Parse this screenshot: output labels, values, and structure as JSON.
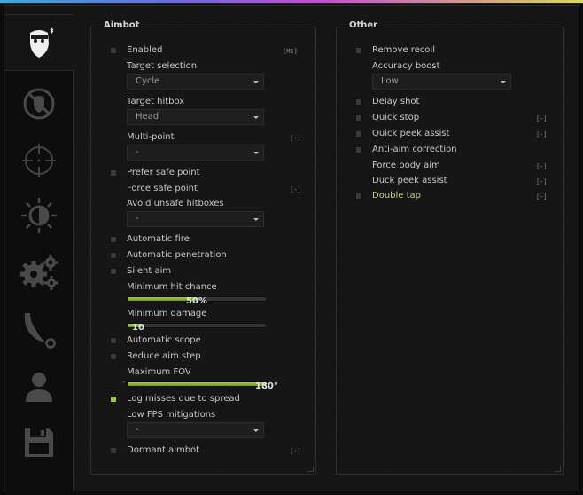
{
  "sidebar": {
    "tabs": [
      {
        "icon": "terrorist-head-icon",
        "active": true
      },
      {
        "icon": "anti-aim-icon",
        "active": false
      },
      {
        "icon": "crosshair-icon",
        "active": false
      },
      {
        "icon": "visuals-icon",
        "active": false
      },
      {
        "icon": "gears-icon",
        "active": false
      },
      {
        "icon": "knife-icon",
        "active": false
      },
      {
        "icon": "player-icon",
        "active": false
      },
      {
        "icon": "save-icon",
        "active": false
      }
    ]
  },
  "aimbot": {
    "title": "Aimbot",
    "enabled": "Enabled",
    "enabled_key": "[M5]",
    "target_selection": "Target selection",
    "target_selection_value": "Cycle",
    "target_hitbox": "Target hitbox",
    "target_hitbox_value": "Head",
    "multi_point": "Multi-point",
    "multi_point_key": "[-]",
    "multi_point_value": "-",
    "prefer_safe_point": "Prefer safe point",
    "force_safe_point": "Force safe point",
    "force_safe_point_key": "[-]",
    "avoid_unsafe_hitboxes": "Avoid unsafe hitboxes",
    "avoid_unsafe_value": "-",
    "automatic_fire": "Automatic fire",
    "automatic_penetration": "Automatic penetration",
    "silent_aim": "Silent aim",
    "min_hit_chance": "Minimum hit chance",
    "min_hit_chance_value": "50%",
    "min_hit_chance_level": 50,
    "min_damage": "Minimum damage",
    "min_damage_value": "10",
    "min_damage_level": 10,
    "automatic_scope": "Automatic scope",
    "reduce_aim_step": "Reduce aim step",
    "max_fov": "Maximum FOV",
    "max_fov_value": "180°",
    "max_fov_level": 100,
    "max_fov_minus": "-",
    "log_misses": "Log misses due to spread",
    "low_fps": "Low FPS mitigations",
    "low_fps_value": "-",
    "dormant_aimbot": "Dormant aimbot",
    "dormant_key": "[-]"
  },
  "other": {
    "title": "Other",
    "remove_recoil": "Remove recoil",
    "accuracy_boost": "Accuracy boost",
    "accuracy_boost_value": "Low",
    "delay_shot": "Delay shot",
    "quick_stop": "Quick stop",
    "quick_stop_key": "[-]",
    "quick_peek": "Quick peek assist",
    "quick_peek_key": "[-]",
    "anti_aim_correction": "Anti-aim correction",
    "force_body_aim": "Force body aim",
    "force_body_aim_key": "[-]",
    "duck_peek": "Duck peek assist",
    "duck_peek_key": "[-]",
    "double_tap": "Double tap",
    "double_tap_key": "[-]"
  },
  "colors": {
    "accent": "#9ec63a",
    "highlight_text": "#c9cf88"
  }
}
